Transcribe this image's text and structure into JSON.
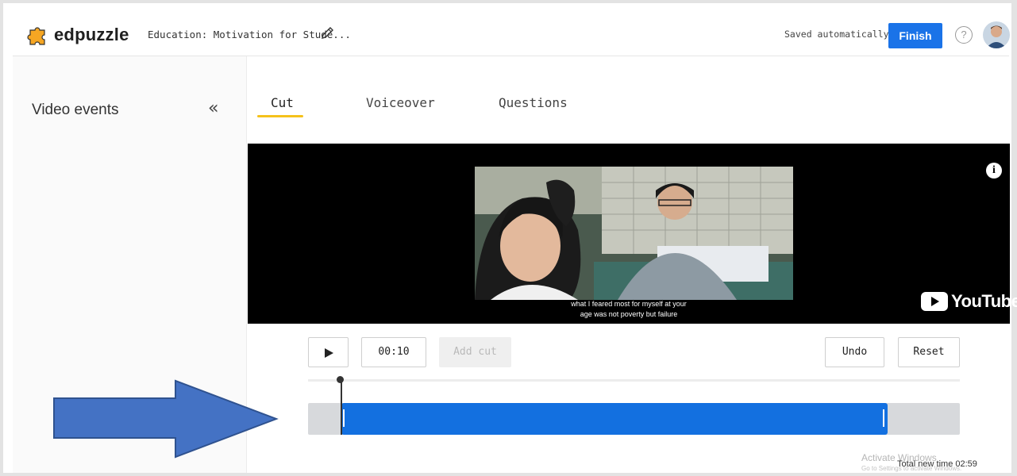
{
  "app": {
    "name": "edpuzzle",
    "brand_color": "#f5a623",
    "accent": "#1a73e8"
  },
  "header": {
    "doc_title": "Education: Motivation for Stude...",
    "saved_status": "Saved automatically",
    "finish_label": "Finish",
    "help_label": "?"
  },
  "sidebar": {
    "title": "Video events",
    "collapse_icon": "«"
  },
  "tabs": [
    {
      "label": "Cut",
      "active": true
    },
    {
      "label": "Voiceover",
      "active": false
    },
    {
      "label": "Questions",
      "active": false
    }
  ],
  "video": {
    "caption_line1": "what I feared most for myself at your",
    "caption_line2": "age was not poverty but failure",
    "info_icon": "i",
    "provider": "YouTube"
  },
  "controls": {
    "time": "00:10",
    "add_cut_label": "Add cut",
    "undo_label": "Undo",
    "reset_label": "Reset"
  },
  "footer": {
    "total_label": "Total new time 02:59",
    "watermark_title": "Activate Windows",
    "watermark_sub": "Go to Settings to activate Windows."
  }
}
